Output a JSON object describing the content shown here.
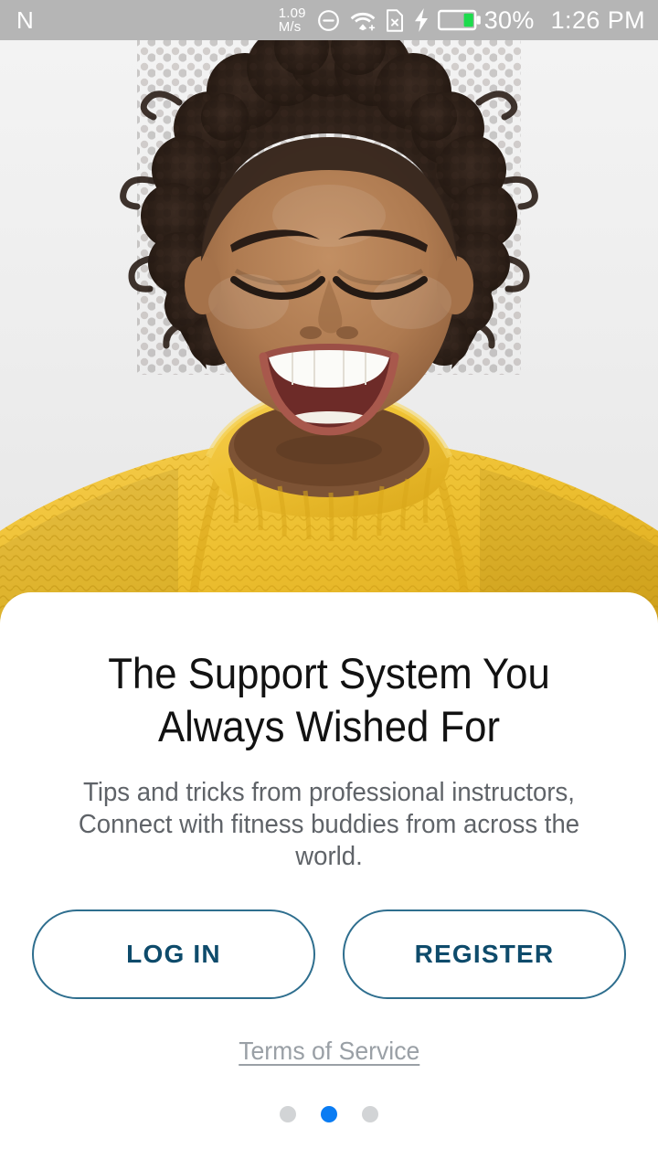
{
  "statusbar": {
    "nfc_label": "N",
    "nfc_icon": "nfc-icon",
    "net_speed_value": "1.09",
    "net_speed_unit": "M/s",
    "dnd_icon": "do-not-disturb-icon",
    "wifi_icon": "wifi-icon",
    "sim_icon": "no-sim-card-icon",
    "charging_icon": "charging-bolt-icon",
    "battery_icon": "battery-icon",
    "battery_percent": "30%",
    "clock": "1:26 PM"
  },
  "hero": {
    "alt": "smiling-woman-in-yellow-knit-sweater",
    "background_color": "#efefef",
    "sweater_color": "#f2c33c",
    "skin_color": "#a9774f",
    "hair_color": "#2e211b"
  },
  "card": {
    "headline": "The Support System You Always Wished For",
    "subtitle": "Tips and tricks from professional instructors, Connect with fitness buddies from across the world.",
    "login_label": "LOG IN",
    "register_label": "REGISTER",
    "terms_label": "Terms of Service"
  },
  "pagination": {
    "total": 3,
    "active_index": 1,
    "active_color": "#0a7cf3",
    "inactive_color": "#d2d4d6"
  },
  "theme": {
    "button_border": "#2e6e8e",
    "button_text": "#0e4b6b",
    "headline_color": "#121212",
    "subtitle_color": "#5f6368",
    "link_color": "#9aa0a6",
    "statusbar_bg": "#b5b5b5",
    "card_bg": "#ffffff"
  }
}
